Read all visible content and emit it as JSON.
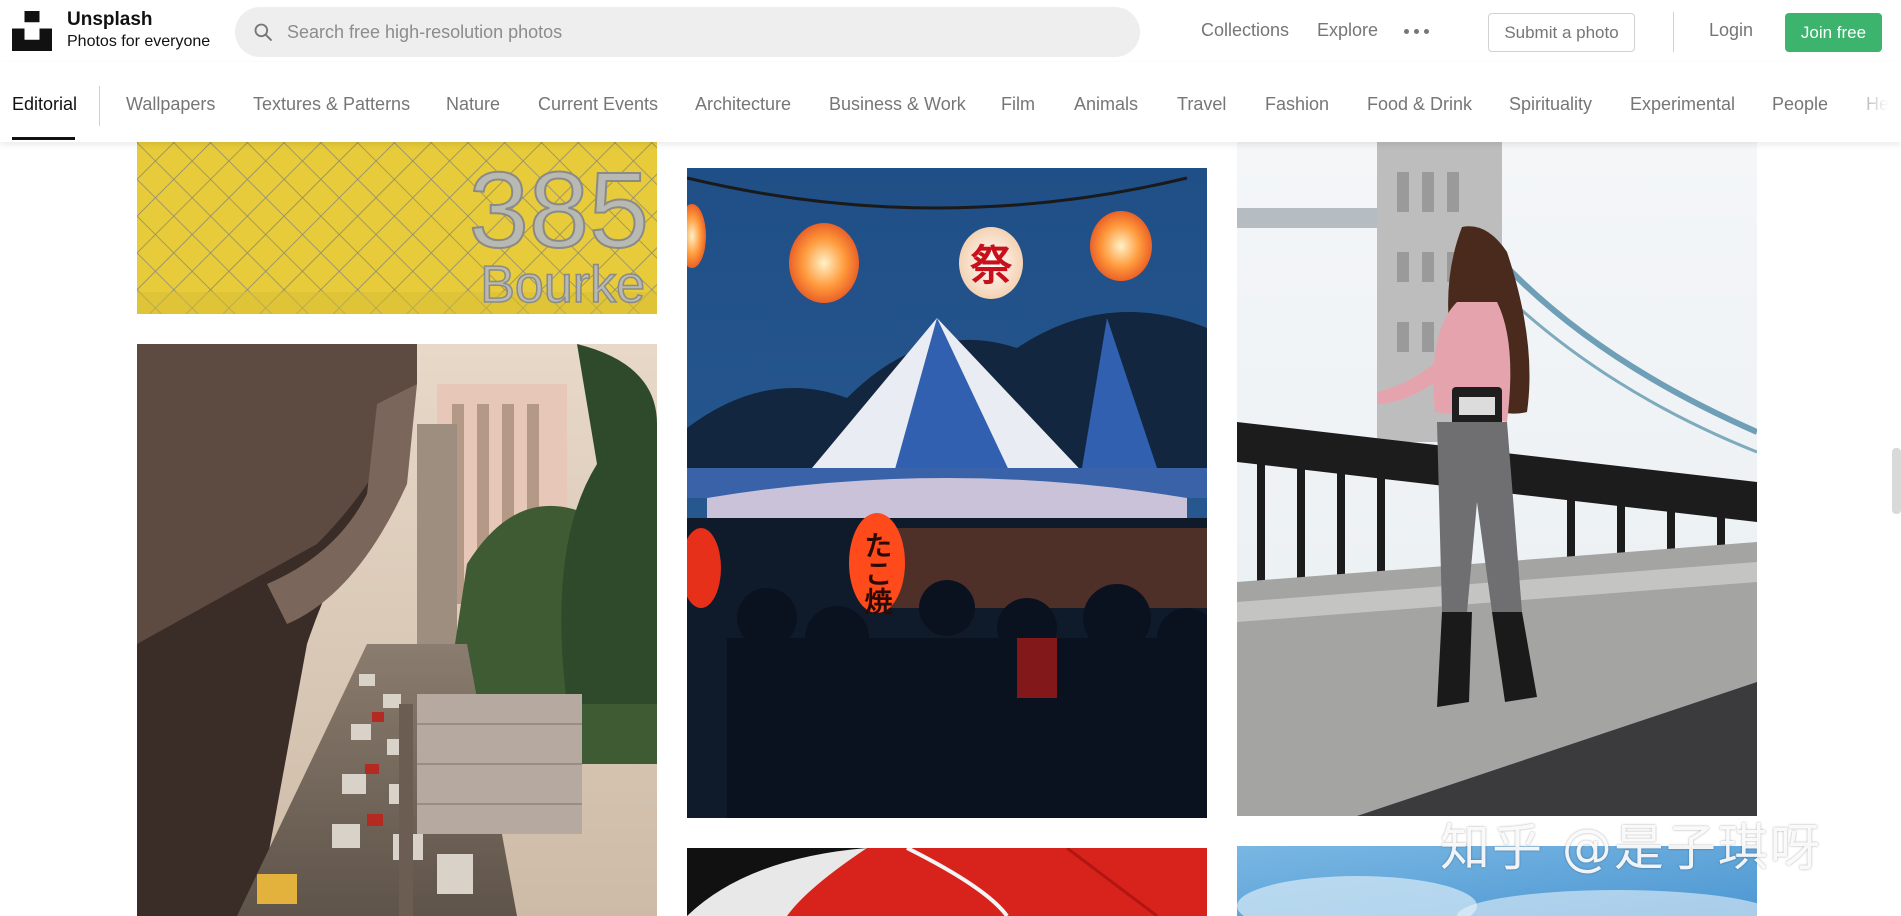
{
  "brand": {
    "name": "Unsplash",
    "tagline": "Photos for everyone"
  },
  "search": {
    "placeholder": "Search free high-resolution photos",
    "value": ""
  },
  "nav": {
    "collections": "Collections",
    "explore": "Explore",
    "submit": "Submit a photo",
    "login": "Login",
    "join": "Join free"
  },
  "categories": [
    {
      "label": "Editorial",
      "active": true
    },
    {
      "label": "Wallpapers"
    },
    {
      "label": "Textures & Patterns"
    },
    {
      "label": "Nature"
    },
    {
      "label": "Current Events"
    },
    {
      "label": "Architecture"
    },
    {
      "label": "Business & Work"
    },
    {
      "label": "Film"
    },
    {
      "label": "Animals"
    },
    {
      "label": "Travel"
    },
    {
      "label": "Fashion"
    },
    {
      "label": "Food & Drink"
    },
    {
      "label": "Spirituality"
    },
    {
      "label": "Experimental"
    },
    {
      "label": "People"
    },
    {
      "label": "He"
    }
  ],
  "photos": {
    "sign_number": "385",
    "sign_street": "Bourke",
    "lantern_kanji": "祭",
    "lantern_red_text": "たこ焼"
  },
  "watermark": "知乎 @是子琪呀",
  "colors": {
    "join_button": "#3cb46e",
    "text_muted": "#767676",
    "search_bg": "#eeeeee"
  }
}
